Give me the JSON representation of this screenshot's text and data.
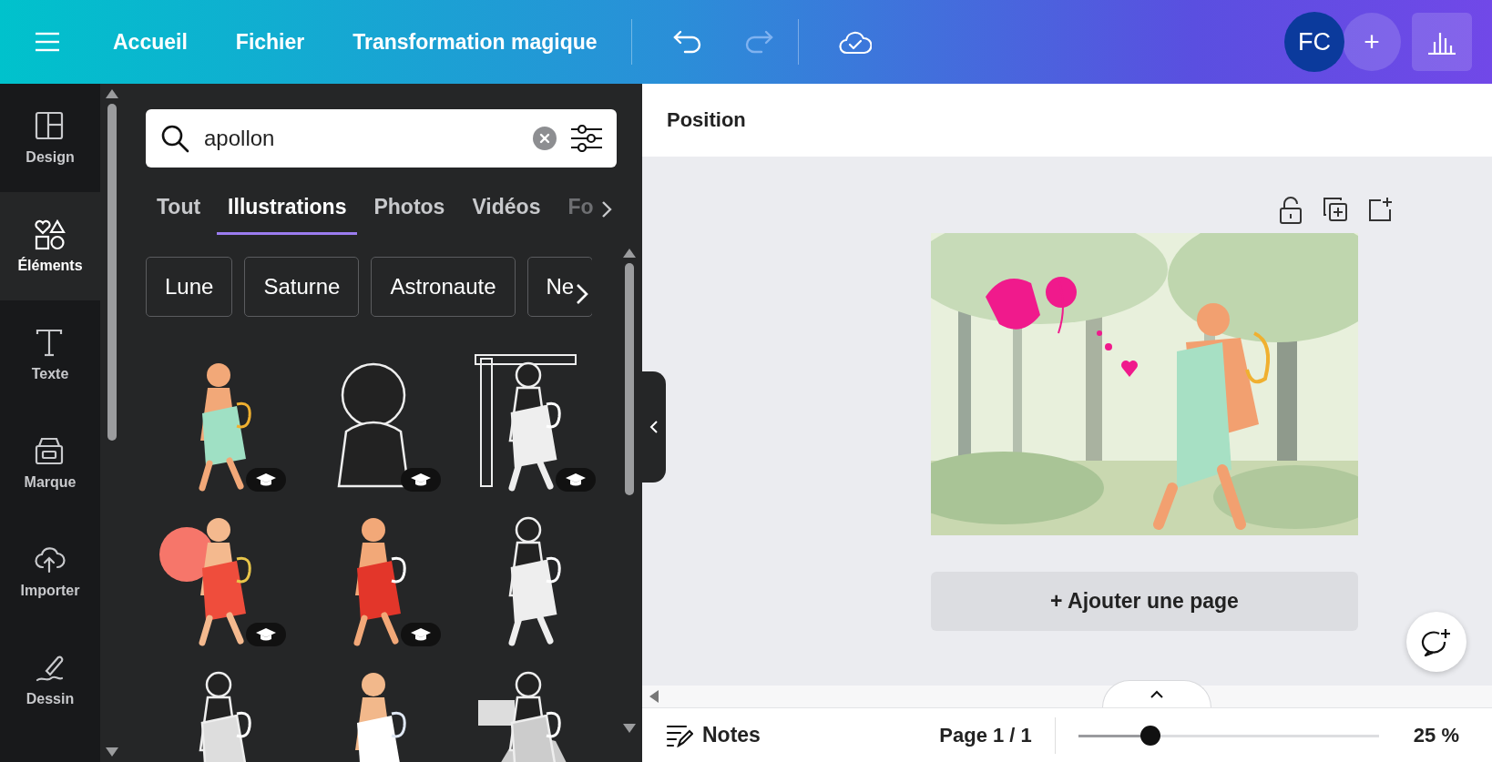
{
  "top_bar": {
    "menu": [
      "Accueil",
      "Fichier",
      "Transformation magique"
    ],
    "avatar": "FC",
    "add": "+"
  },
  "sidebar": {
    "items": [
      {
        "label": "Design",
        "selected": false
      },
      {
        "label": "Éléments",
        "selected": true
      },
      {
        "label": "Texte",
        "selected": false
      },
      {
        "label": "Marque",
        "selected": false
      },
      {
        "label": "Importer",
        "selected": false
      },
      {
        "label": "Dessin",
        "selected": false
      }
    ]
  },
  "panel": {
    "search": {
      "value": "apollon"
    },
    "tabs": [
      {
        "label": "Tout",
        "selected": false
      },
      {
        "label": "Illustrations",
        "selected": true
      },
      {
        "label": "Photos",
        "selected": false
      },
      {
        "label": "Vidéos",
        "selected": false
      },
      {
        "label": "Fo",
        "selected": false
      }
    ],
    "chips": [
      "Lune",
      "Saturne",
      "Astronaute",
      "Ne"
    ],
    "results": [
      {
        "kind": "picture",
        "premium": true
      },
      {
        "kind": "picture",
        "premium": true
      },
      {
        "kind": "picture",
        "premium": true
      },
      {
        "kind": "picture",
        "premium": true
      },
      {
        "kind": "picture",
        "premium": true
      },
      {
        "kind": "picture",
        "premium": false
      },
      {
        "kind": "picture",
        "premium": false
      },
      {
        "kind": "picture",
        "premium": false
      },
      {
        "kind": "picture",
        "premium": false
      }
    ]
  },
  "editor": {
    "header": "Position",
    "add_page": "+ Ajouter une page"
  },
  "footer": {
    "notes": "Notes",
    "page": "Page 1 / 1",
    "zoom": {
      "level": 0.24
    },
    "zoom_reading": "25 %"
  }
}
